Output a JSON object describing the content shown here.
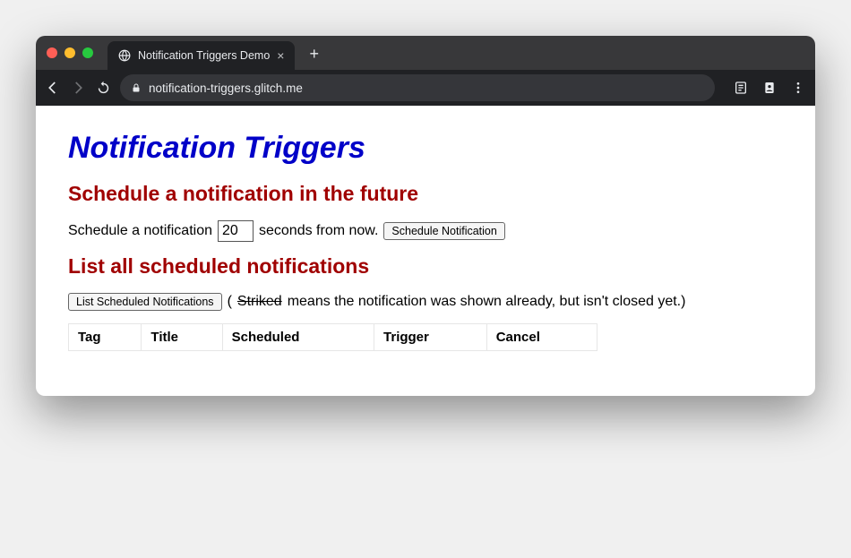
{
  "browser": {
    "tab_title": "Notification Triggers Demo",
    "url": "notification-triggers.glitch.me"
  },
  "page": {
    "h1": "Notification Triggers",
    "schedule": {
      "h2": "Schedule a notification in the future",
      "prefix": "Schedule a notification",
      "value": "20",
      "suffix": "seconds from now.",
      "button": "Schedule Notification"
    },
    "list": {
      "h2": "List all scheduled notifications",
      "button": "List Scheduled Notifications",
      "note_open": "(",
      "note_striked": "Striked",
      "note_rest": " means the notification was shown already, but isn't closed yet.)",
      "columns": [
        "Tag",
        "Title",
        "Scheduled",
        "Trigger",
        "Cancel"
      ]
    }
  }
}
